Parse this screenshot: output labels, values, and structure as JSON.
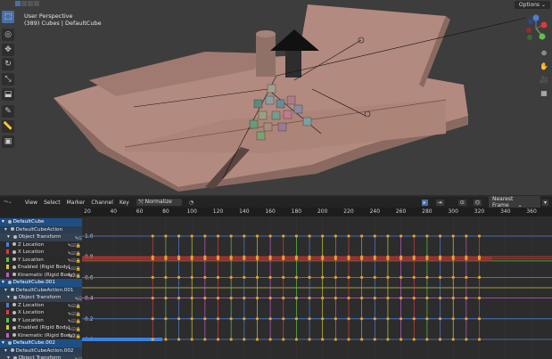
{
  "viewport": {
    "mode_label": "User Perspective",
    "selection_label": "(389) Cubes | DefaultCube",
    "options_label": "Options ⌄",
    "axis_labels": [
      "X",
      "Y",
      "Z"
    ]
  },
  "toolbar": {
    "icons": [
      "select-box-icon",
      "cursor-icon",
      "move-icon",
      "rotate-icon",
      "scale-icon",
      "transform-icon",
      "annotate-icon",
      "measure-icon",
      "add-cube-icon"
    ]
  },
  "nav": {
    "icons": [
      "zoom-icon",
      "pan-icon",
      "camera-icon",
      "grid-icon"
    ]
  },
  "graph_header": {
    "menus": [
      "View",
      "Select",
      "Marker",
      "Channel",
      "Key"
    ],
    "normalize_label": "Normalize",
    "snap_label": "Nearest Frame"
  },
  "ruler": {
    "ticks": [
      "20",
      "40",
      "60",
      "80",
      "100",
      "120",
      "140",
      "160",
      "180",
      "200",
      "220",
      "240",
      "260",
      "280",
      "300",
      "320",
      "340",
      "360"
    ]
  },
  "y_labels": [
    "1.0",
    "0.8",
    "0.6",
    "0.4",
    "0.2",
    "0.0"
  ],
  "channels": [
    {
      "type": "obj",
      "label": "DefaultCube"
    },
    {
      "type": "act",
      "label": "DefaultCubeAction"
    },
    {
      "type": "grp",
      "label": "Object Transform"
    },
    {
      "type": "fc",
      "label": "Z Location",
      "color": "#4a7fd6"
    },
    {
      "type": "fc",
      "label": "X Location",
      "color": "#d63c3c"
    },
    {
      "type": "fc",
      "label": "Y Location",
      "color": "#5bc24a"
    },
    {
      "type": "fc",
      "label": "Enabled (Rigid Body)",
      "color": "#c8c840"
    },
    {
      "type": "fc",
      "label": "Kinematic (Rigid Body)",
      "color": "#c05ac8"
    },
    {
      "type": "obj",
      "label": "DefaultCube.001"
    },
    {
      "type": "act",
      "label": "DefaultCubeAction.001"
    },
    {
      "type": "grp",
      "label": "Object Transform"
    },
    {
      "type": "fc",
      "label": "Z Location",
      "color": "#4a7fd6"
    },
    {
      "type": "fc",
      "label": "X Location",
      "color": "#d63c3c"
    },
    {
      "type": "fc",
      "label": "Y Location",
      "color": "#5bc24a"
    },
    {
      "type": "fc",
      "label": "Enabled (Rigid Body)",
      "color": "#c8c840"
    },
    {
      "type": "fc",
      "label": "Kinematic (Rigid Body)",
      "color": "#c05ac8"
    },
    {
      "type": "obj",
      "label": "DefaultCube.002"
    },
    {
      "type": "act",
      "label": "DefaultCubeAction.002"
    },
    {
      "type": "grp",
      "label": "Object Transform"
    }
  ],
  "keyframe_frames": [
    70,
    80,
    90,
    100,
    110,
    120,
    130,
    140,
    150,
    160,
    170,
    180,
    190,
    200,
    210,
    220,
    230,
    240,
    250,
    260,
    270,
    280,
    290,
    300,
    310,
    320
  ],
  "colors": {
    "accent": "#4a6fa5",
    "keyframe": "#e8a030",
    "object_row": "#1d4f85"
  }
}
